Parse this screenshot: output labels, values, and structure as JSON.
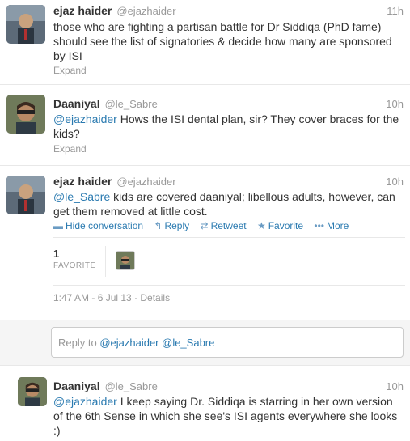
{
  "tweets": [
    {
      "name": "ejaz haider",
      "handle": "@ejazhaider",
      "time": "11h",
      "text_lines": [
        "those who are fighting a partisan battle for Dr Siddiqa (PhD fame)",
        "should see the list of signatories & decide how many are sponsored",
        "by ISI"
      ],
      "expand": "Expand"
    },
    {
      "name": "Daaniyal",
      "handle": "@le_Sabre",
      "time": "10h",
      "mention": "@ejazhaider",
      "text_after_mention": " Hows the ISI dental plan, sir? They cover braces for the",
      "text_line2": "kids?",
      "expand": "Expand"
    },
    {
      "name": "ejaz haider",
      "handle": "@ejazhaider",
      "time": "10h",
      "mention": "@le_Sabre",
      "text_after_mention": " kids are covered daaniyal; libellous adults, however, can",
      "text_line2": "get them removed at little cost.",
      "actions": {
        "hide": "Hide conversation",
        "reply": "Reply",
        "retweet": "Retweet",
        "favorite": "Favorite",
        "more": "More"
      },
      "fav_count": "1",
      "fav_label": "FAVORITE",
      "meta": "1:47 AM - 6 Jul 13 · Details"
    },
    {
      "name": "Daaniyal",
      "handle": "@le_Sabre",
      "time": "10h",
      "mention": "@ejazhaider",
      "text_after_mention": " I keep saying Dr. Siddiqa is starring in her own version",
      "text_line2": "of the 6th Sense in which she see's ISI agents everywhere she looks",
      "text_line3": ":)"
    }
  ],
  "reply": {
    "prefix": "Reply to",
    "mentions": "@ejazhaider @le_Sabre"
  },
  "icons": {
    "hide": "conversation-icon",
    "reply": "reply-arrow-icon",
    "retweet": "retweet-icon",
    "favorite": "star-icon",
    "more": "more-dots-icon"
  },
  "colors": {
    "link": "#2a7ab0",
    "muted": "#999999",
    "text": "#333333"
  }
}
